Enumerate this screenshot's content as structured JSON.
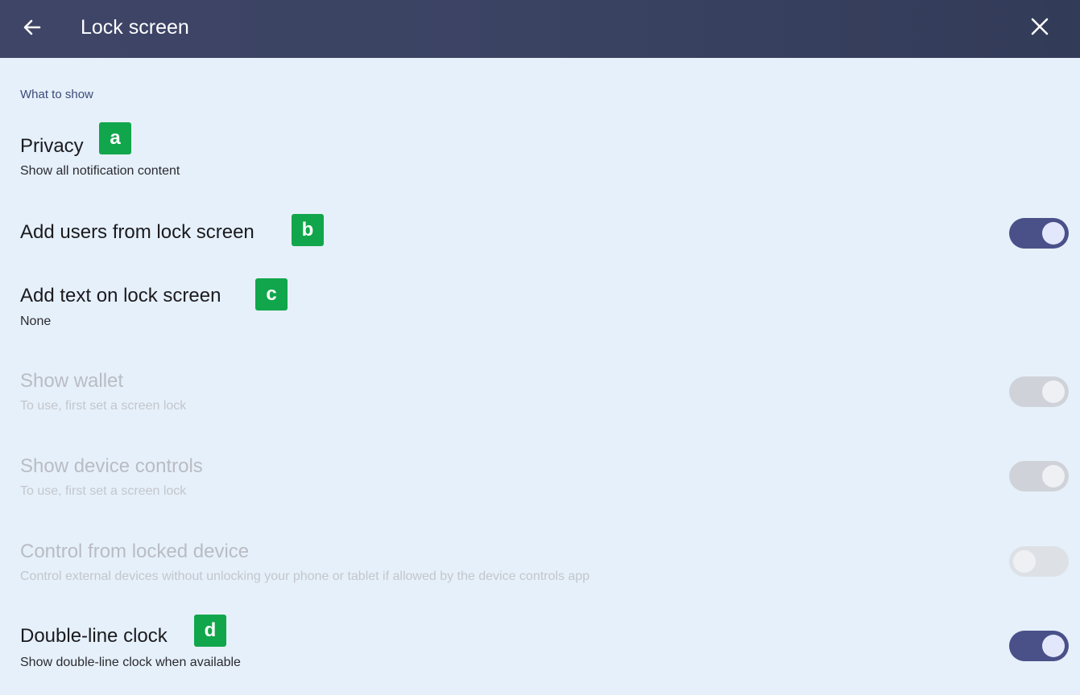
{
  "header": {
    "title": "Lock screen"
  },
  "section": {
    "label": "What to show"
  },
  "settings": [
    {
      "title": "Privacy",
      "subtitle": "Show all notification content",
      "badge": "a"
    },
    {
      "title": "Add users from lock screen",
      "badge": "b",
      "toggle": "on"
    },
    {
      "title": "Add text on lock screen",
      "subtitle": "None",
      "badge": "c"
    },
    {
      "title": "Show wallet",
      "subtitle": "To use, first set a screen lock",
      "toggle": "on",
      "enabled": false
    },
    {
      "title": "Show device controls",
      "subtitle": "To use, first set a screen lock",
      "toggle": "on",
      "enabled": false
    },
    {
      "title": "Control from locked device",
      "subtitle": "Control external devices without unlocking your phone or tablet if allowed by the device controls app",
      "toggle": "off",
      "enabled": false
    },
    {
      "title": "Double-line clock",
      "subtitle": "Show double-line clock when available",
      "badge": "d",
      "toggle": "on"
    }
  ],
  "icons": {
    "back": "arrow-left-icon",
    "close": "close-icon"
  },
  "colors": {
    "header_bg": "#3b4363",
    "page_bg": "#e6f0fa",
    "toggle_on": "#4a5189",
    "badge": "#11a64b",
    "section_label": "#3d4a78"
  }
}
